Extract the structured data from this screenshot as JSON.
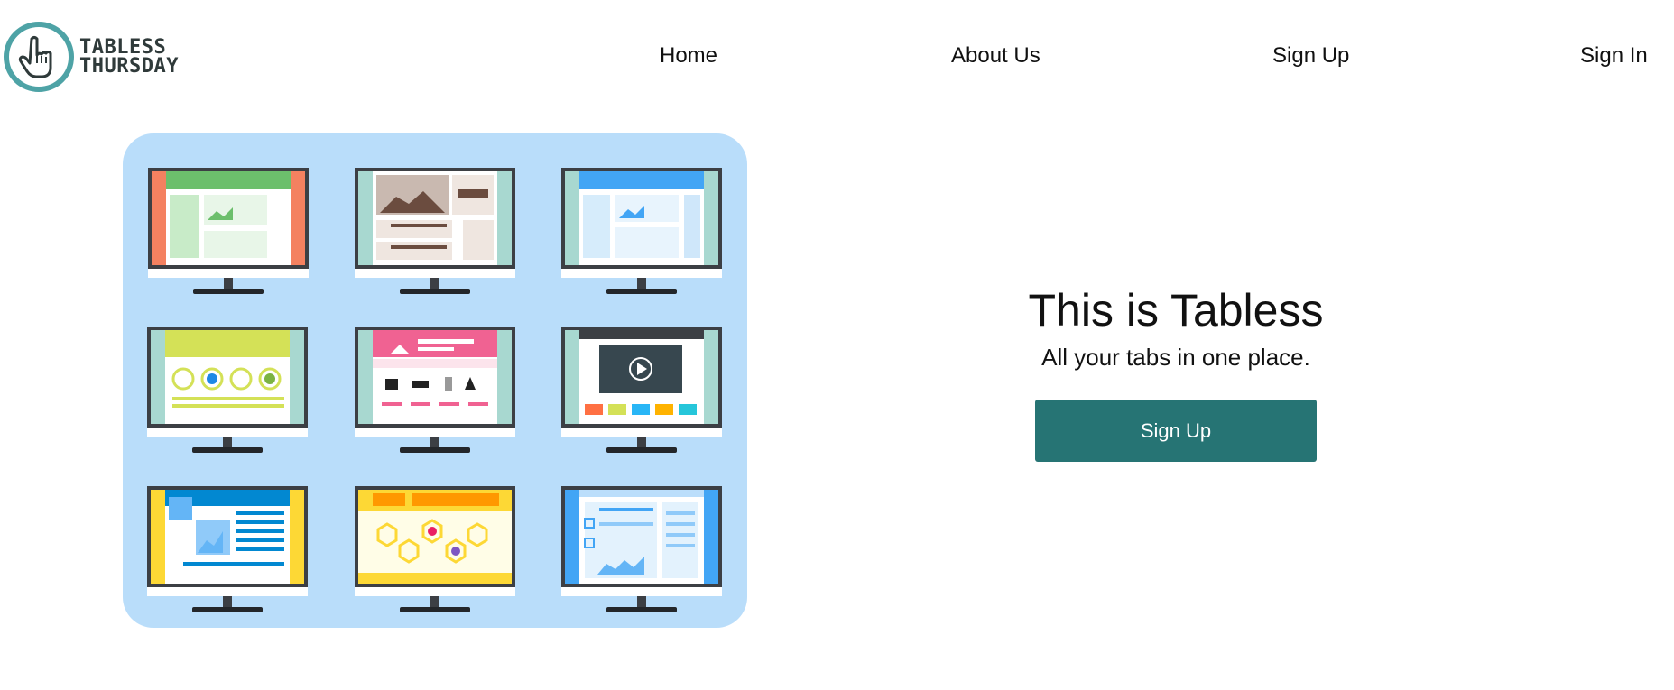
{
  "brand": {
    "line1": "TABLESS",
    "line2": "THURSDAY",
    "logo_icon": "pointer-hand-icon"
  },
  "nav": {
    "home": "Home",
    "about": "About Us",
    "signup": "Sign Up",
    "signin": "Sign In"
  },
  "hero": {
    "title": "This is Tabless",
    "subtitle": "All your tabs in one place.",
    "cta_label": "Sign Up"
  },
  "illustration": {
    "name": "website-mockups-illustration",
    "background": "#b9ddfa"
  },
  "colors": {
    "accent": "#267474",
    "logo_ring": "#4ea3a6"
  }
}
